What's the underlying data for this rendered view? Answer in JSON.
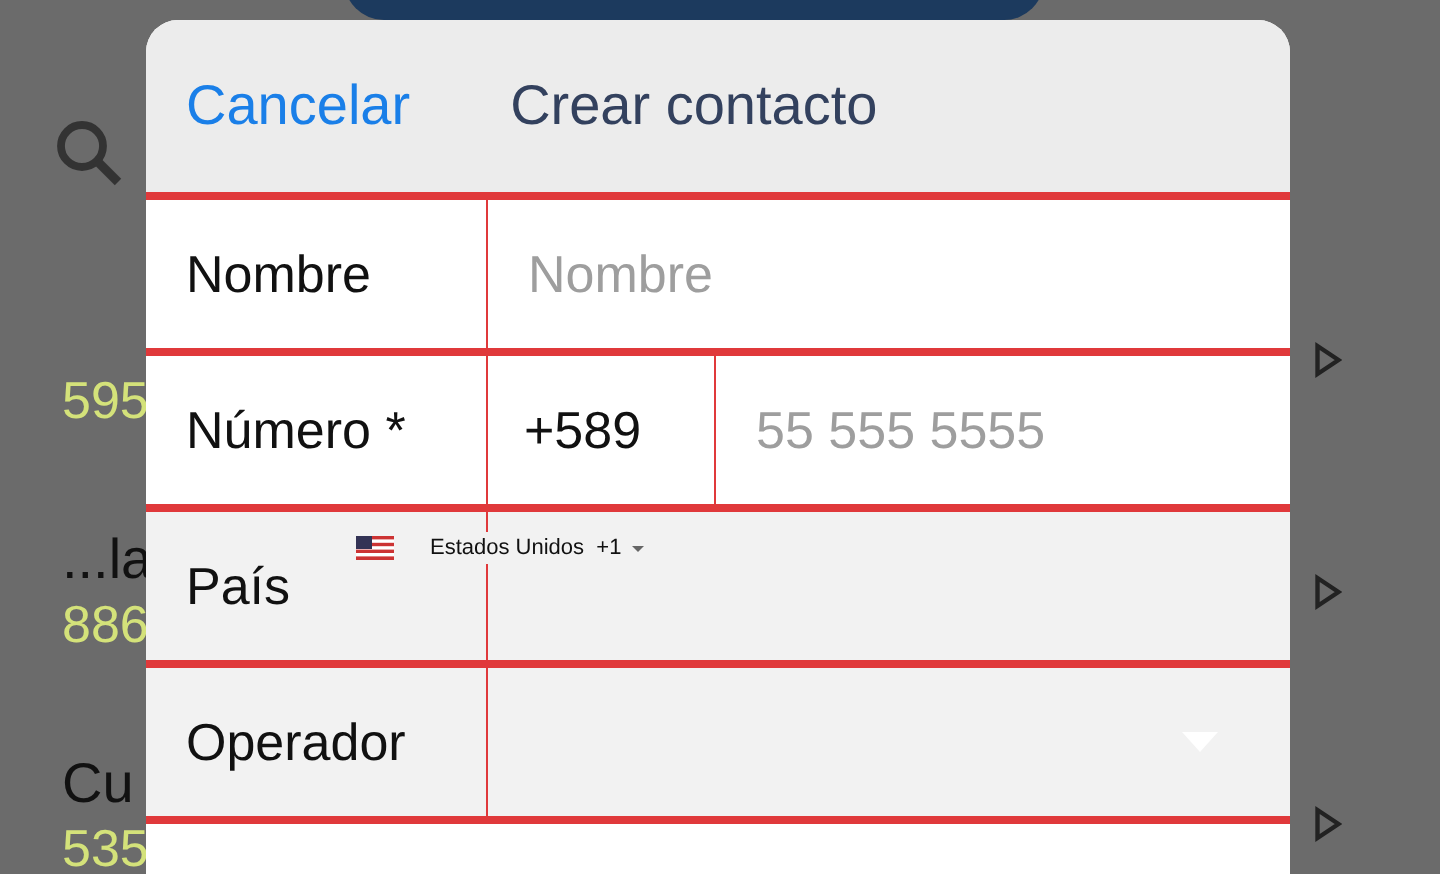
{
  "background_list": [
    {
      "number": "595"
    },
    {
      "name": "...la",
      "number": "886"
    },
    {
      "name": "Cu",
      "number": "535"
    }
  ],
  "dialog": {
    "cancel": "Cancelar",
    "title": "Crear contacto",
    "fields": [
      {
        "kind": "text",
        "label": "Nombre",
        "placeholder": "Nombre"
      },
      {
        "kind": "phone",
        "label": "Número *",
        "prefix": "+589",
        "placeholder": "55 555 5555"
      },
      {
        "kind": "country",
        "label": "País",
        "value": "Estados Unidos  +1"
      },
      {
        "kind": "select",
        "label": "Operador"
      },
      {
        "kind": "blank"
      }
    ]
  }
}
